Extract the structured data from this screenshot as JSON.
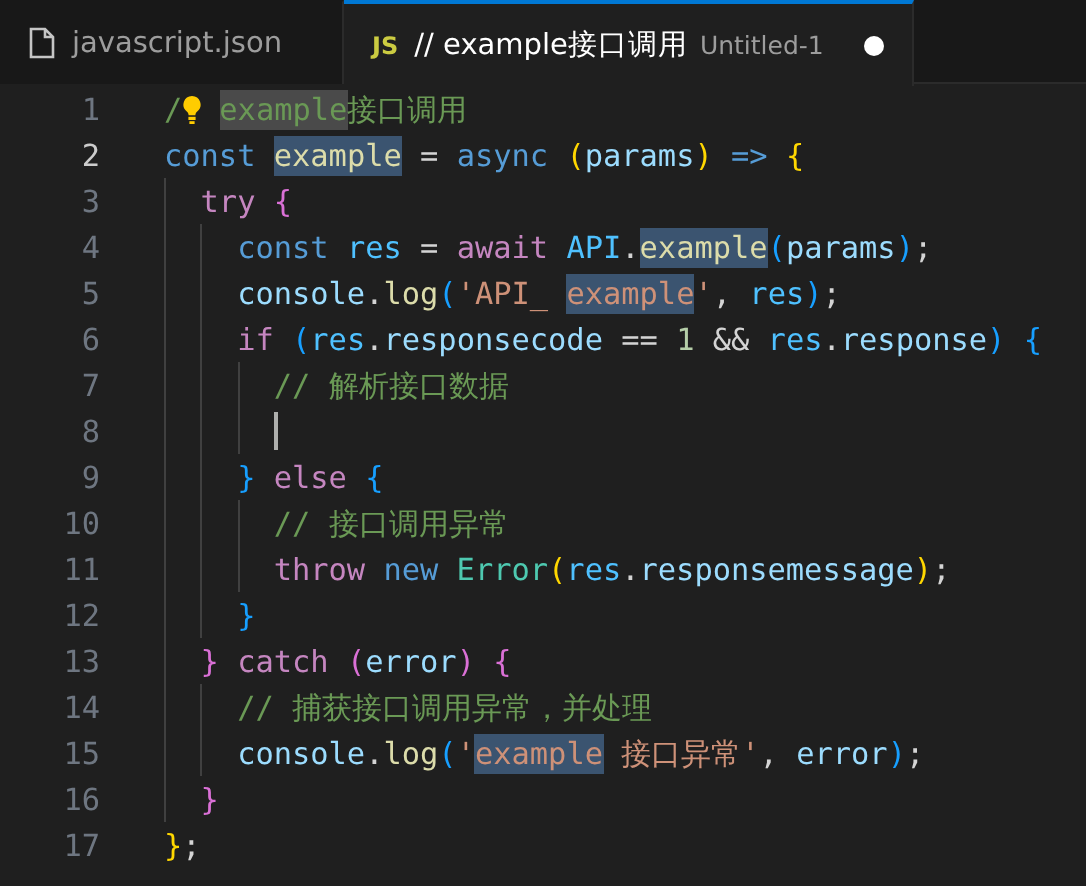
{
  "tabs": [
    {
      "kind": "file",
      "label": "javascript.json",
      "selected": false,
      "dirty": false
    },
    {
      "kind": "script",
      "icon_text": "JS",
      "label": "// example接口调用",
      "description": "Untitled-1",
      "selected": true,
      "dirty": true
    }
  ],
  "editor": {
    "lines": [
      {
        "number": "1",
        "active": false,
        "tokens": [
          {
            "t": "/",
            "kind": "comment"
          },
          {
            "kind": "bulb"
          },
          {
            "t": "example",
            "kind": "comment",
            "highlighted": true
          },
          {
            "t": "接口调用",
            "kind": "comment"
          }
        ]
      },
      {
        "number": "2",
        "active": true,
        "tokens": [
          {
            "t": "const ",
            "kind": "keyword"
          },
          {
            "t": "example",
            "kind": "function",
            "highlighted": true
          },
          {
            "t": " = ",
            "kind": "plain"
          },
          {
            "t": "async ",
            "kind": "keyword"
          },
          {
            "t": "(",
            "kind": "bracket1"
          },
          {
            "t": "params",
            "kind": "variable"
          },
          {
            "t": ")",
            "kind": "bracket1"
          },
          {
            "t": " => ",
            "kind": "keyword"
          },
          {
            "t": "{",
            "kind": "bracket1"
          }
        ],
        "children": [
          {
            "number": "3",
            "active": false,
            "tokens": [
              {
                "t": "try ",
                "kind": "control"
              },
              {
                "t": "{",
                "kind": "bracket2"
              }
            ],
            "children": [
              {
                "number": "4",
                "active": false,
                "tokens": [
                  {
                    "t": "const ",
                    "kind": "keyword"
                  },
                  {
                    "t": "res",
                    "kind": "constant"
                  },
                  {
                    "t": " = ",
                    "kind": "plain"
                  },
                  {
                    "t": "await ",
                    "kind": "control"
                  },
                  {
                    "t": "API",
                    "kind": "constant"
                  },
                  {
                    "t": ".",
                    "kind": "plain"
                  },
                  {
                    "t": "example",
                    "kind": "function",
                    "highlighted": true
                  },
                  {
                    "t": "(",
                    "kind": "bracket3"
                  },
                  {
                    "t": "params",
                    "kind": "variable"
                  },
                  {
                    "t": ")",
                    "kind": "bracket3"
                  },
                  {
                    "t": ";",
                    "kind": "plain"
                  }
                ]
              },
              {
                "number": "5",
                "active": false,
                "tokens": [
                  {
                    "t": "console",
                    "kind": "variable"
                  },
                  {
                    "t": ".",
                    "kind": "plain"
                  },
                  {
                    "t": "log",
                    "kind": "function"
                  },
                  {
                    "t": "(",
                    "kind": "bracket3"
                  },
                  {
                    "t": "'API_ ",
                    "kind": "string"
                  },
                  {
                    "t": "example",
                    "kind": "string",
                    "highlighted": true
                  },
                  {
                    "t": "'",
                    "kind": "string"
                  },
                  {
                    "t": ", ",
                    "kind": "plain"
                  },
                  {
                    "t": "res",
                    "kind": "constant"
                  },
                  {
                    "t": ")",
                    "kind": "bracket3"
                  },
                  {
                    "t": ";",
                    "kind": "plain"
                  }
                ]
              },
              {
                "number": "6",
                "active": false,
                "tokens": [
                  {
                    "t": "if ",
                    "kind": "control"
                  },
                  {
                    "t": "(",
                    "kind": "bracket3"
                  },
                  {
                    "t": "res",
                    "kind": "constant"
                  },
                  {
                    "t": ".",
                    "kind": "plain"
                  },
                  {
                    "t": "responsecode",
                    "kind": "variable"
                  },
                  {
                    "t": " == ",
                    "kind": "plain"
                  },
                  {
                    "t": "1",
                    "kind": "number"
                  },
                  {
                    "t": " && ",
                    "kind": "plain"
                  },
                  {
                    "t": "res",
                    "kind": "constant"
                  },
                  {
                    "t": ".",
                    "kind": "plain"
                  },
                  {
                    "t": "response",
                    "kind": "variable"
                  },
                  {
                    "t": ") ",
                    "kind": "bracket3"
                  },
                  {
                    "t": "{",
                    "kind": "bracket3"
                  }
                ],
                "children": [
                  {
                    "number": "7",
                    "active": false,
                    "tokens": [
                      {
                        "t": "// 解析接口数据",
                        "kind": "comment"
                      }
                    ]
                  },
                  {
                    "number": "8",
                    "active": false,
                    "cursor": true
                  }
                ]
              },
              {
                "number": "9",
                "active": false,
                "tokens": [
                  {
                    "t": "}",
                    "kind": "bracket3"
                  },
                  {
                    "t": " else ",
                    "kind": "control"
                  },
                  {
                    "t": "{",
                    "kind": "bracket3"
                  }
                ],
                "children": [
                  {
                    "number": "10",
                    "active": false,
                    "tokens": [
                      {
                        "t": "// 接口调用异常",
                        "kind": "comment"
                      }
                    ]
                  },
                  {
                    "number": "11",
                    "active": false,
                    "tokens": [
                      {
                        "t": "throw ",
                        "kind": "control"
                      },
                      {
                        "t": "new ",
                        "kind": "keyword"
                      },
                      {
                        "t": "Error",
                        "kind": "class"
                      },
                      {
                        "t": "(",
                        "kind": "bracket1"
                      },
                      {
                        "t": "res",
                        "kind": "constant"
                      },
                      {
                        "t": ".",
                        "kind": "plain"
                      },
                      {
                        "t": "responsemessage",
                        "kind": "variable"
                      },
                      {
                        "t": ")",
                        "kind": "bracket1"
                      },
                      {
                        "t": ";",
                        "kind": "plain"
                      }
                    ]
                  }
                ]
              },
              {
                "number": "12",
                "active": false,
                "tokens": [
                  {
                    "t": "}",
                    "kind": "bracket3"
                  }
                ]
              }
            ]
          },
          {
            "number": "13",
            "active": false,
            "tokens": [
              {
                "t": "}",
                "kind": "bracket2"
              },
              {
                "t": " catch ",
                "kind": "control"
              },
              {
                "t": "(",
                "kind": "bracket2"
              },
              {
                "t": "error",
                "kind": "variable"
              },
              {
                "t": ") ",
                "kind": "bracket2"
              },
              {
                "t": "{",
                "kind": "bracket2"
              }
            ],
            "children": [
              {
                "number": "14",
                "active": false,
                "tokens": [
                  {
                    "t": "// 捕获接口调用异常，并处理",
                    "kind": "comment"
                  }
                ]
              },
              {
                "number": "15",
                "active": false,
                "tokens": [
                  {
                    "t": "console",
                    "kind": "variable"
                  },
                  {
                    "t": ".",
                    "kind": "plain"
                  },
                  {
                    "t": "log",
                    "kind": "function"
                  },
                  {
                    "t": "(",
                    "kind": "bracket3"
                  },
                  {
                    "t": "'",
                    "kind": "string"
                  },
                  {
                    "t": "example",
                    "kind": "string",
                    "highlighted": true
                  },
                  {
                    "t": " 接口异常'",
                    "kind": "string"
                  },
                  {
                    "t": ", ",
                    "kind": "plain"
                  },
                  {
                    "t": "error",
                    "kind": "variable"
                  },
                  {
                    "t": ")",
                    "kind": "bracket3"
                  },
                  {
                    "t": ";",
                    "kind": "plain"
                  }
                ]
              }
            ]
          },
          {
            "number": "16",
            "active": false,
            "tokens": [
              {
                "t": "}",
                "kind": "bracket2"
              }
            ]
          }
        ]
      },
      {
        "number": "17",
        "active": false,
        "tokens": [
          {
            "t": "}",
            "kind": "bracket1"
          },
          {
            "t": ";",
            "kind": "plain"
          }
        ]
      }
    ]
  }
}
